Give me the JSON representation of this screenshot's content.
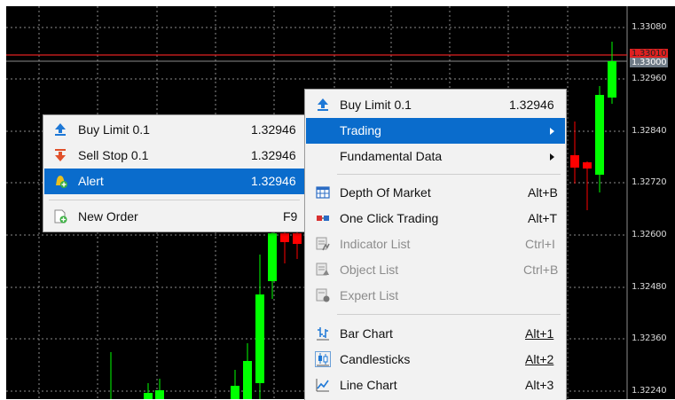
{
  "price_scale": {
    "labels": [
      "1.33080",
      "1.32960",
      "1.32840",
      "1.32720",
      "1.32600",
      "1.32480",
      "1.32360",
      "1.32240"
    ],
    "ask_label": "1.33010",
    "bid_label": "1.33000"
  },
  "colors": {
    "background": "#000000",
    "bull": "#00ff00",
    "bear": "#ff0000",
    "grid": "#8c8c8c",
    "menu_bg": "#f2f2f2",
    "selection": "#0a6ccc"
  },
  "left_menu": {
    "items": [
      {
        "label": "Buy Limit 0.1",
        "value": "1.32946",
        "icon": "buy-limit-arrow-icon"
      },
      {
        "label": "Sell Stop 0.1",
        "value": "1.32946",
        "icon": "sell-stop-arrow-icon"
      },
      {
        "label": "Alert",
        "value": "1.32946",
        "icon": "alert-bell-icon",
        "selected": true
      },
      {
        "label": "New Order",
        "value": "F9",
        "icon": "new-order-icon"
      }
    ]
  },
  "main_menu": {
    "items": [
      {
        "label": "Buy Limit 0.1",
        "value": "1.32946",
        "icon": "buy-limit-arrow-icon"
      },
      {
        "label": "Trading",
        "submenu": true,
        "selected": true
      },
      {
        "label": "Fundamental Data",
        "submenu": true
      },
      {
        "label": "Depth Of Market",
        "shortcut": "Alt+B",
        "icon": "depth-of-market-icon"
      },
      {
        "label": "One Click Trading",
        "shortcut": "Alt+T",
        "icon": "one-click-trading-icon"
      },
      {
        "label": "Indicator List",
        "shortcut": "Ctrl+I",
        "icon": "indicator-list-icon",
        "disabled": true
      },
      {
        "label": "Object List",
        "shortcut": "Ctrl+B",
        "icon": "object-list-icon",
        "disabled": true
      },
      {
        "label": "Expert List",
        "icon": "expert-list-icon",
        "disabled": true
      },
      {
        "label": "Bar Chart",
        "shortcut": "Alt+1",
        "icon": "bar-chart-icon"
      },
      {
        "label": "Candlesticks",
        "shortcut": "Alt+2",
        "icon": "candlesticks-icon"
      },
      {
        "label": "Line Chart",
        "shortcut": "Alt+3",
        "icon": "line-chart-icon"
      }
    ]
  }
}
